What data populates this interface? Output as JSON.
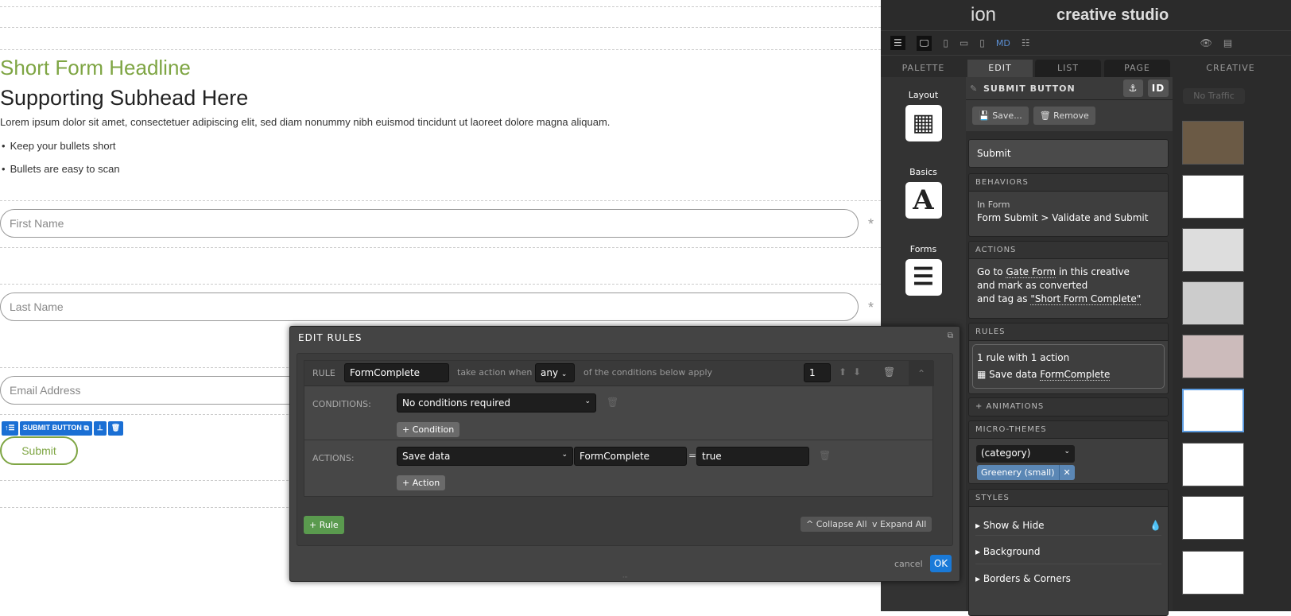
{
  "canvas": {
    "headline": "Short Form Headline",
    "subhead": "Supporting Subhead Here",
    "body": "Lorem ipsum dolor sit amet, consectetuer adipiscing elit, sed diam nonummy nibh euismod tincidunt ut laoreet dolore magna aliquam.",
    "bullets": [
      "Keep your bullets short",
      "Bullets are easy to scan"
    ],
    "fields": [
      {
        "placeholder": "First Name",
        "required": "*"
      },
      {
        "placeholder": "Last Name",
        "required": "*"
      },
      {
        "placeholder": "Email Address"
      }
    ],
    "selection_label": "SUBMIT BUTTON",
    "submit_label": "Submit"
  },
  "header": {
    "logo": "ion",
    "title": "creative studio",
    "breakpoint": "MD"
  },
  "tabs": {
    "palette": "PALETTE",
    "edit": "EDIT",
    "list": "LIST",
    "page": "PAGE",
    "creative": "CREATIVE"
  },
  "palette": [
    {
      "label": "Layout"
    },
    {
      "label": "Basics",
      "glyph": "A"
    },
    {
      "label": "Forms"
    }
  ],
  "edit": {
    "title": "SUBMIT BUTTON",
    "id_label": "ID",
    "save": "Save...",
    "remove": "Remove",
    "name_value": "Submit",
    "behaviors": {
      "title": "BEHAVIORS",
      "context": "In Form",
      "value": "Form Submit > Validate and Submit"
    },
    "actions": {
      "title": "ACTIONS",
      "l1a": "Go to ",
      "l1b": "Gate Form",
      "l1c": " in this creative",
      "l2": "and mark as converted",
      "l3a": "and tag as ",
      "l3b": "\"Short Form Complete\""
    },
    "rules": {
      "title": "RULES",
      "summary": "1 rule with 1 action",
      "item_a": "Save data ",
      "item_b": "FormComplete"
    },
    "animations": "+ ANIMATIONS",
    "micro": {
      "title": "MICRO-THEMES",
      "select": "(category)",
      "tag": "Greenery (small)"
    },
    "styles": {
      "title": "STYLES",
      "items": [
        "Show & Hide",
        "Background",
        "Borders & Corners"
      ]
    }
  },
  "creative": {
    "traffic": "No Traffic"
  },
  "modal": {
    "title": "EDIT RULES",
    "rule_label": "RULE",
    "rule_name": "FormComplete",
    "take_action": "take action when",
    "match": "any",
    "conditions_text": "of the conditions below apply",
    "order": "1",
    "conditions_label": "CONDITIONS:",
    "condition_value": "No conditions required",
    "add_condition": "+ Condition",
    "actions_label": "ACTIONS:",
    "action_value": "Save data",
    "action_key": "FormComplete",
    "equals": "=",
    "action_val": "true",
    "add_action": "+ Action",
    "add_rule": "+ Rule",
    "collapse": "^ Collapse All",
    "expand": "v Expand All",
    "cancel": "cancel",
    "ok": "OK"
  },
  "colors": {
    "accent_green": "#7ea543",
    "selection_blue": "#1a6fd4",
    "ok_blue": "#1a7ad8",
    "tag_blue": "#5b87b5"
  }
}
